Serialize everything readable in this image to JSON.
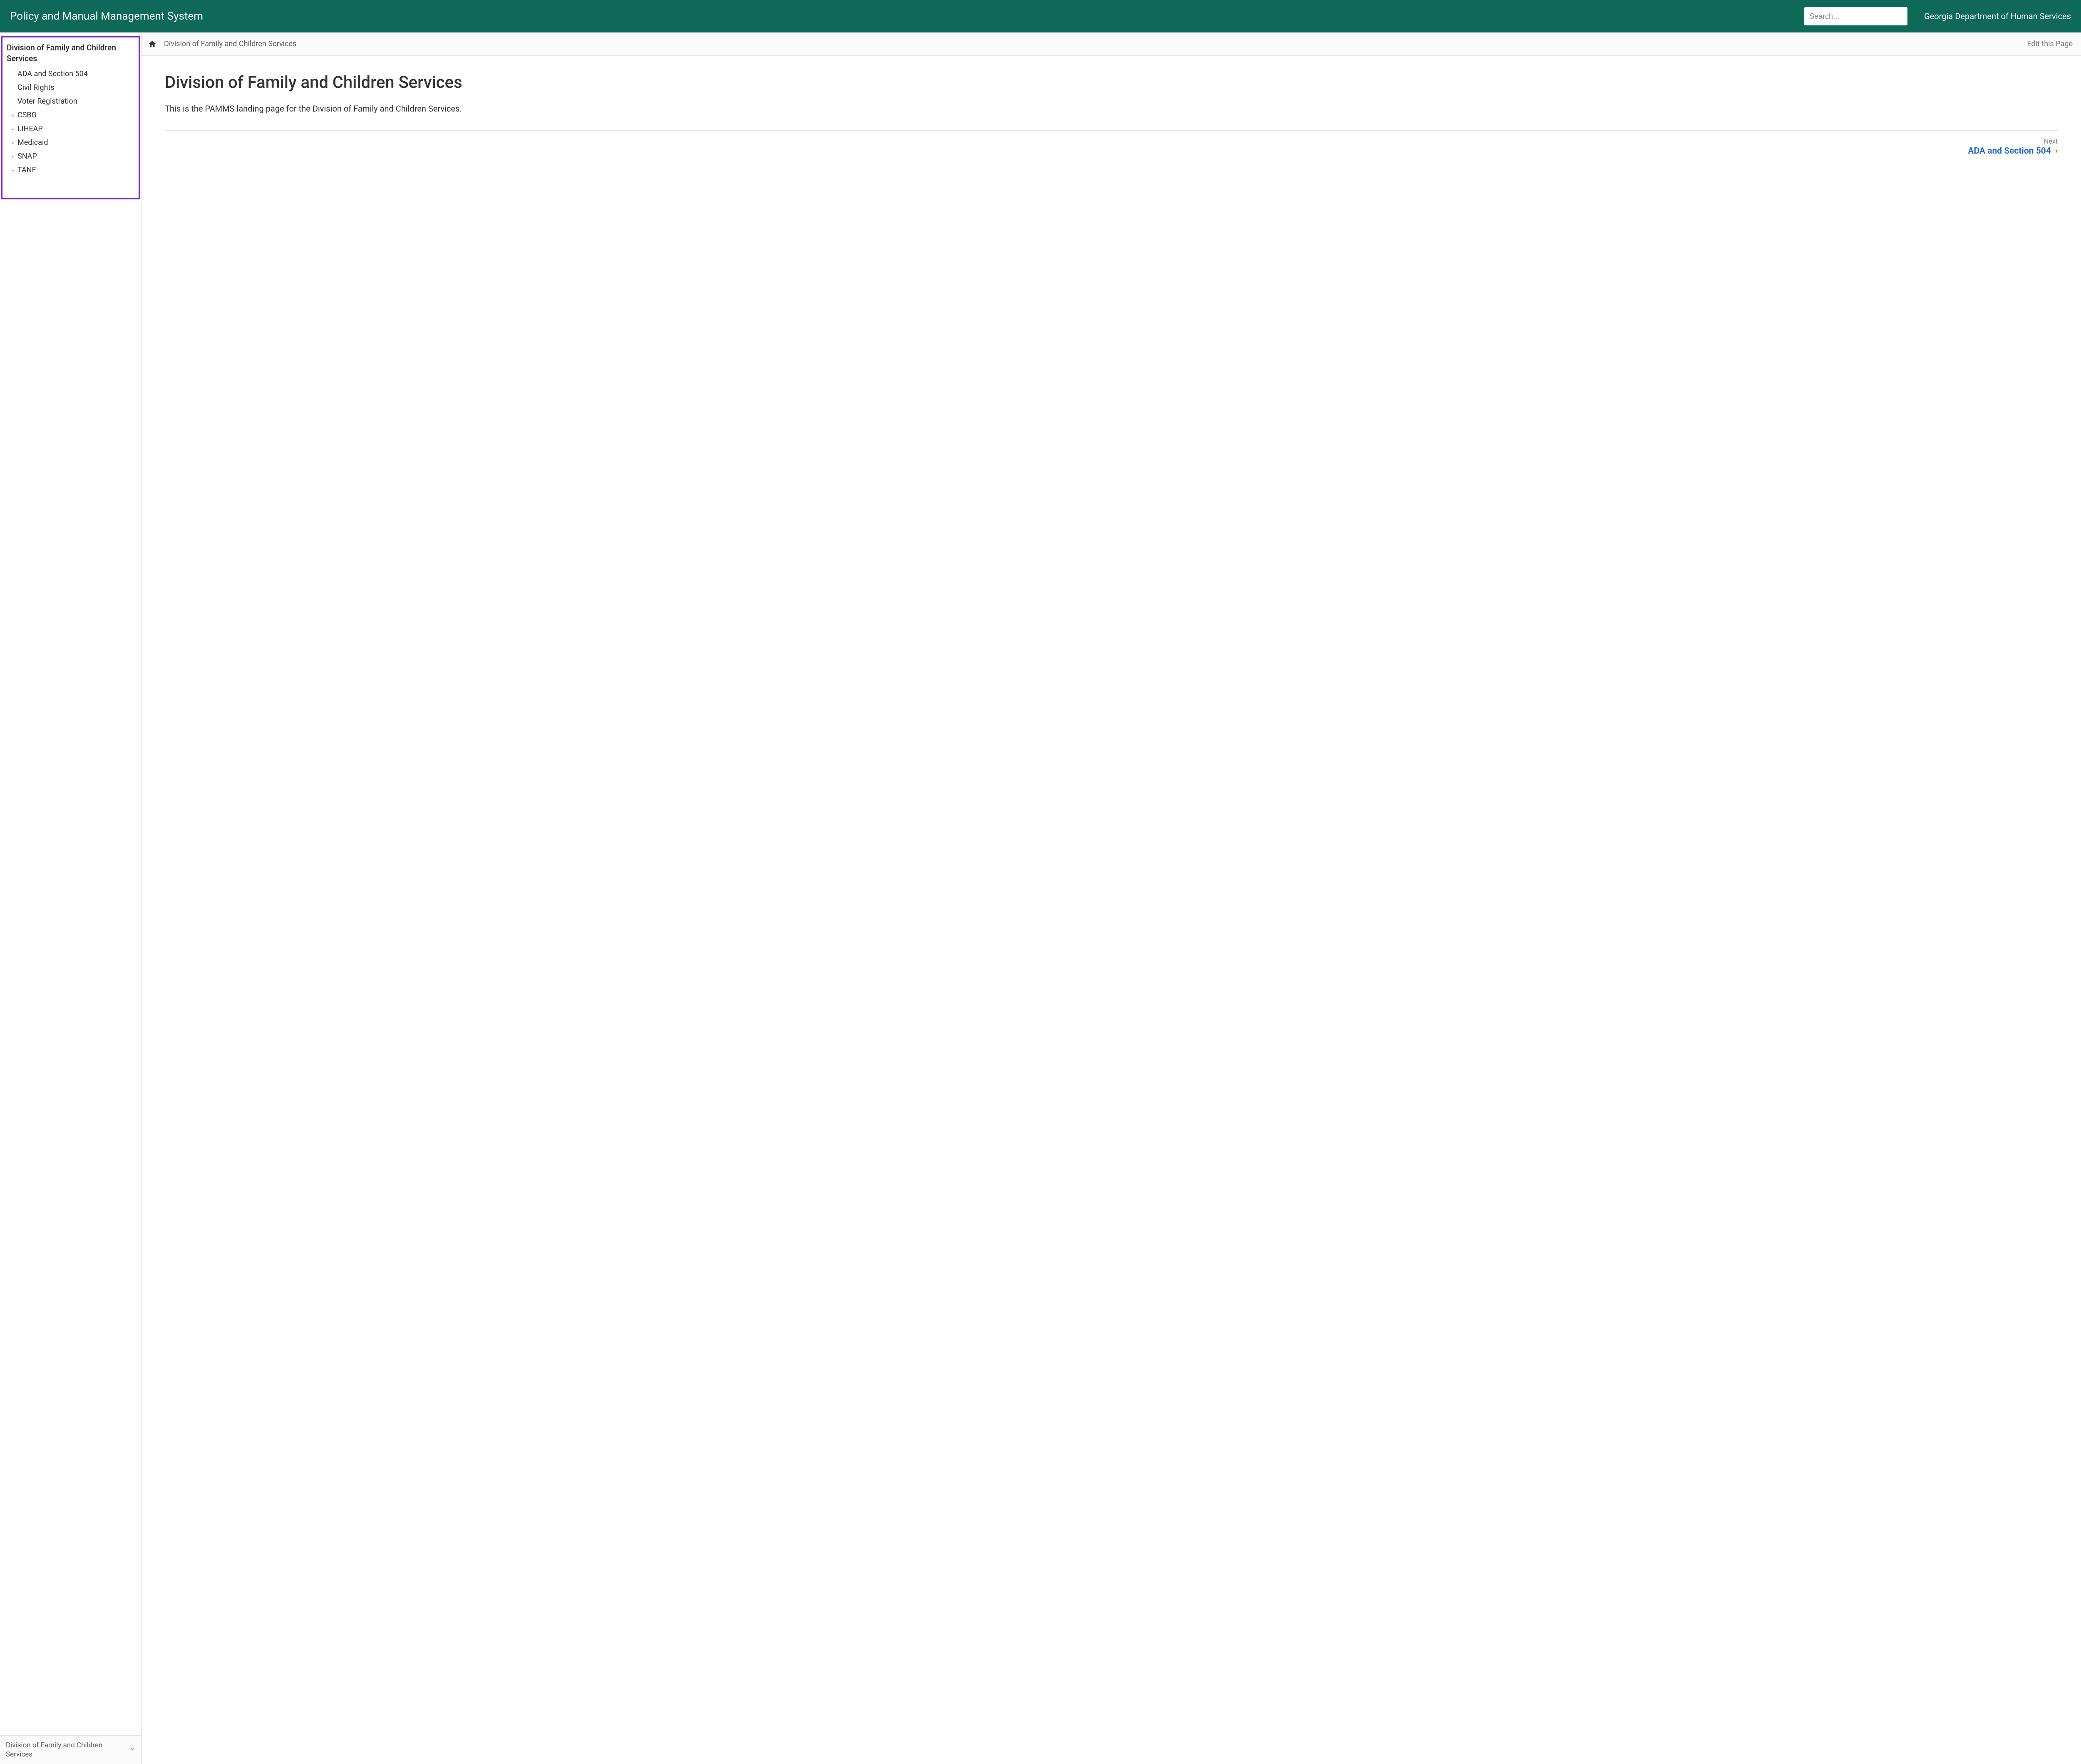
{
  "header": {
    "site_title": "Policy and Manual Management System",
    "search_placeholder": "Search...",
    "org_name": "Georgia Department of Human Services"
  },
  "sidebar": {
    "heading": "Division of Family and Children Services",
    "items": [
      {
        "label": "ADA and Section 504",
        "expandable": false
      },
      {
        "label": "Civil Rights",
        "expandable": false
      },
      {
        "label": "Voter Registration",
        "expandable": false
      },
      {
        "label": "CSBG",
        "expandable": true
      },
      {
        "label": "LIHEAP",
        "expandable": true
      },
      {
        "label": "Medicaid",
        "expandable": true
      },
      {
        "label": "SNAP",
        "expandable": true
      },
      {
        "label": "TANF",
        "expandable": true
      }
    ],
    "footer_label": "Division of Family and Children Services"
  },
  "toolbar": {
    "breadcrumb": "Division of Family and Children Services",
    "edit_label": "Edit this Page"
  },
  "page": {
    "title": "Division of Family and Children Services",
    "body": "This is the PAMMS landing page for the Division of Family and Children Services.",
    "next_hint": "Next",
    "next_label": "ADA and Section 504"
  }
}
